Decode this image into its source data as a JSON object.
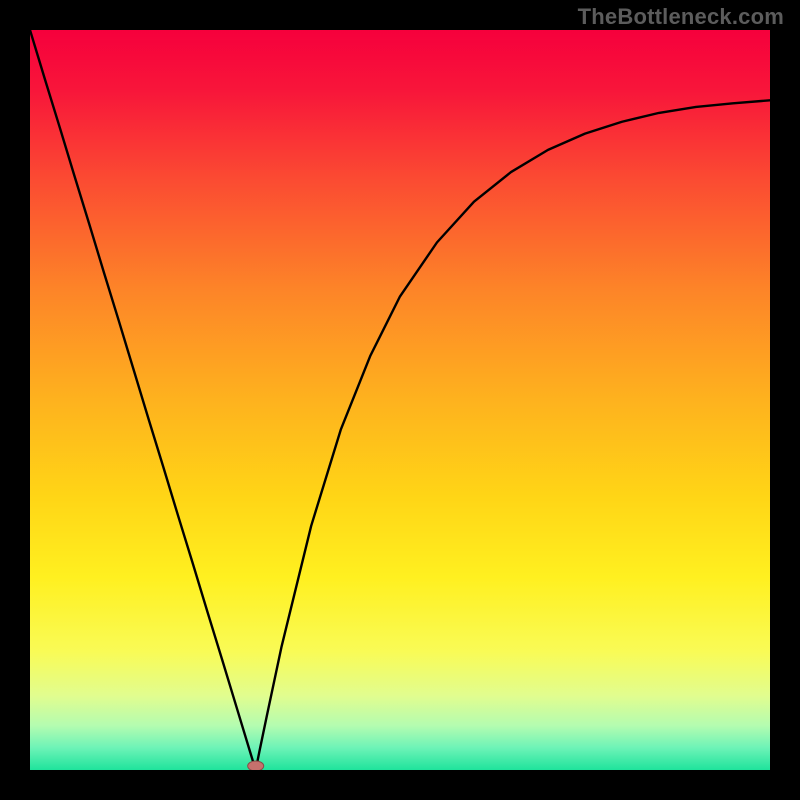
{
  "watermark": "TheBottleneck.com",
  "colors": {
    "background": "#000000",
    "gradient_stops": [
      {
        "offset": 0.0,
        "color": "#f6003c"
      },
      {
        "offset": 0.08,
        "color": "#f8153a"
      },
      {
        "offset": 0.2,
        "color": "#fb4a32"
      },
      {
        "offset": 0.35,
        "color": "#fd8428"
      },
      {
        "offset": 0.5,
        "color": "#feb21e"
      },
      {
        "offset": 0.63,
        "color": "#ffd516"
      },
      {
        "offset": 0.74,
        "color": "#fff020"
      },
      {
        "offset": 0.84,
        "color": "#f9fb56"
      },
      {
        "offset": 0.9,
        "color": "#e1fd8f"
      },
      {
        "offset": 0.94,
        "color": "#b4fcb0"
      },
      {
        "offset": 0.97,
        "color": "#6df3b7"
      },
      {
        "offset": 1.0,
        "color": "#1fe39c"
      }
    ],
    "curve": "#000000",
    "marker_fill": "#c6716d",
    "marker_stroke": "#8a4a47"
  },
  "chart_data": {
    "type": "line",
    "title": "",
    "xlabel": "",
    "ylabel": "",
    "xlim": [
      0,
      1
    ],
    "ylim": [
      0,
      1
    ],
    "grid": false,
    "legend": false,
    "annotations": [
      "TheBottleneck.com"
    ],
    "series": [
      {
        "name": "bottleneck-curve",
        "x": [
          0.0,
          0.02,
          0.04,
          0.06,
          0.08,
          0.1,
          0.12,
          0.14,
          0.16,
          0.18,
          0.2,
          0.22,
          0.24,
          0.26,
          0.28,
          0.3,
          0.305,
          0.31,
          0.32,
          0.34,
          0.38,
          0.42,
          0.46,
          0.5,
          0.55,
          0.6,
          0.65,
          0.7,
          0.75,
          0.8,
          0.85,
          0.9,
          0.95,
          1.0
        ],
        "y": [
          1.0,
          0.934,
          0.869,
          0.803,
          0.738,
          0.672,
          0.607,
          0.541,
          0.475,
          0.41,
          0.344,
          0.279,
          0.213,
          0.148,
          0.082,
          0.016,
          0.0,
          0.025,
          0.073,
          0.167,
          0.33,
          0.46,
          0.56,
          0.64,
          0.713,
          0.768,
          0.808,
          0.838,
          0.86,
          0.876,
          0.888,
          0.896,
          0.901,
          0.905
        ]
      }
    ],
    "marker": {
      "x": 0.305,
      "y": 0.0,
      "shape": "ellipse"
    }
  }
}
